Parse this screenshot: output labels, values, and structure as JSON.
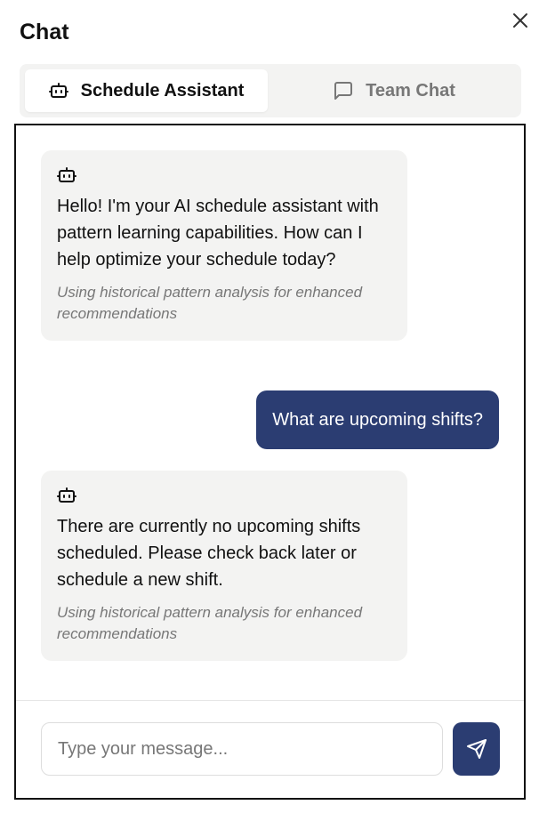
{
  "panel": {
    "title": "Chat"
  },
  "tabs": [
    {
      "label": "Schedule Assistant",
      "icon": "bot-icon",
      "active": true
    },
    {
      "label": "Team Chat",
      "icon": "message-square-icon",
      "active": false
    }
  ],
  "messages": [
    {
      "sender": "assistant",
      "icon": "bot-icon",
      "text": "Hello! I'm your AI schedule assistant with pattern learning capabilities. How can I help optimize your schedule today?",
      "note": "Using historical pattern analysis for enhanced recommendations"
    },
    {
      "sender": "user",
      "text": "What are upcoming shifts?"
    },
    {
      "sender": "assistant",
      "icon": "bot-icon",
      "text": "There are currently no upcoming shifts scheduled. Please check back later or schedule a new shift.",
      "note": "Using historical pattern analysis for enhanced recommendations"
    }
  ],
  "composer": {
    "placeholder": "Type your message...",
    "value": "",
    "send_icon": "send-icon"
  },
  "colors": {
    "accent": "#2b3d72",
    "bubble_bg": "#f3f3f2",
    "muted_text": "#777777"
  }
}
